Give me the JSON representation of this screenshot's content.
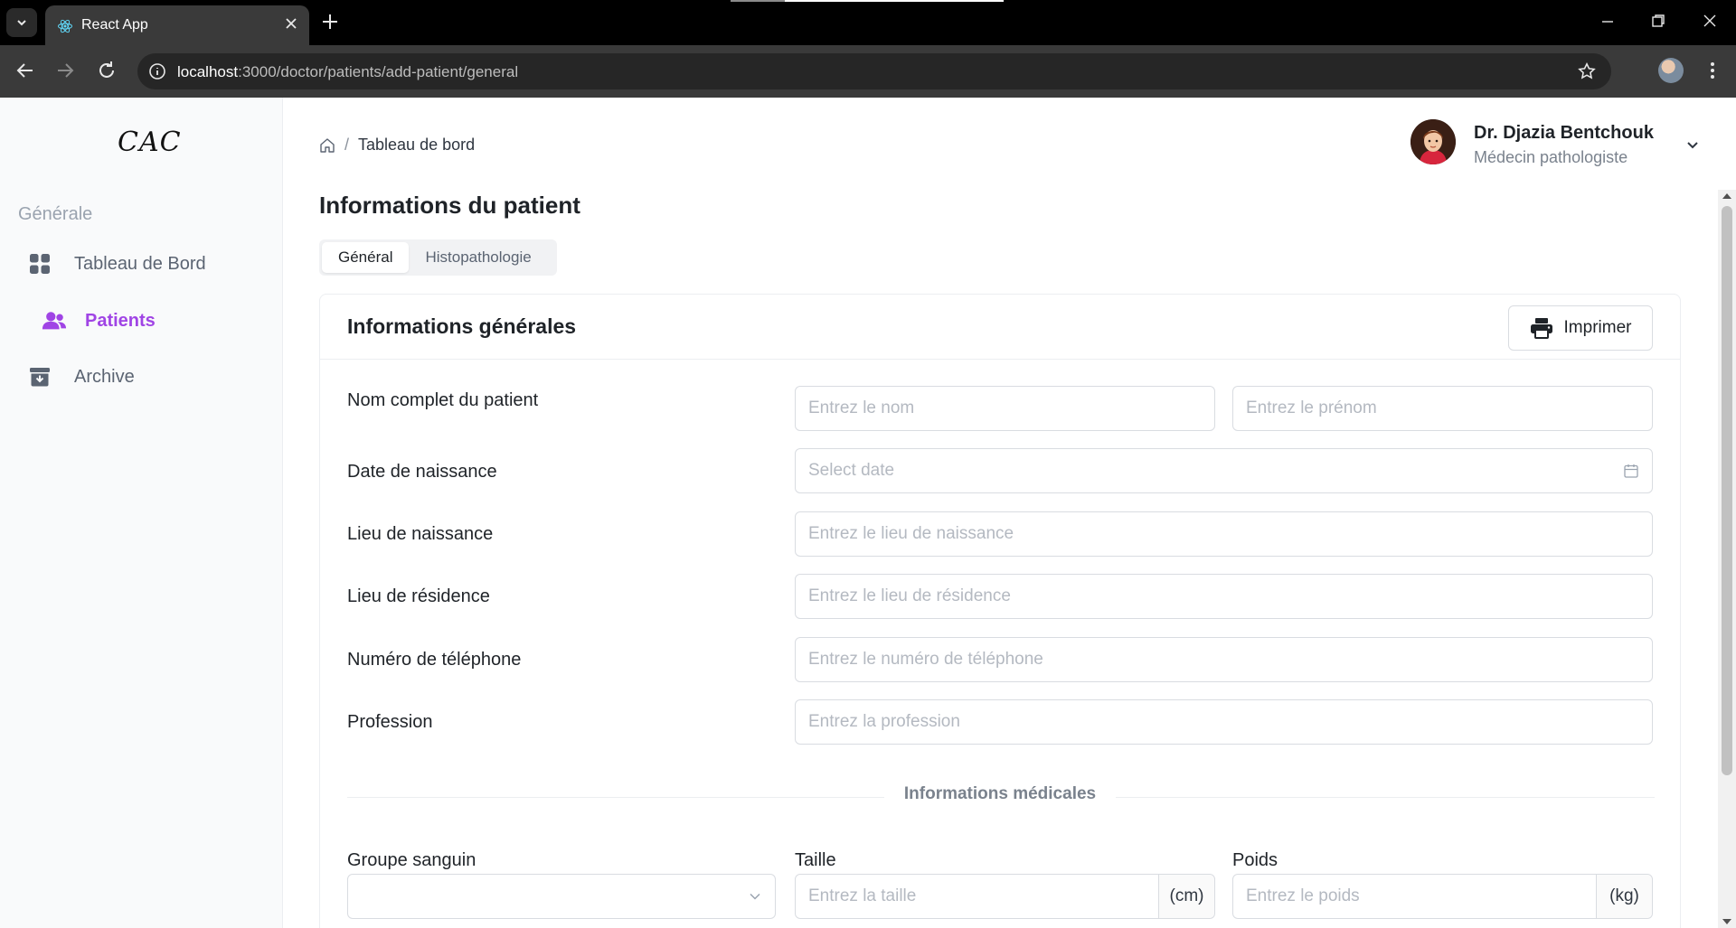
{
  "browser": {
    "tab_title": "React App",
    "url_host": "localhost",
    "url_rest": ":3000/doctor/patients/add-patient/general"
  },
  "sidebar": {
    "logo": "CAC",
    "section": "Générale",
    "items": [
      {
        "label": "Tableau de Bord",
        "icon": "grid-icon",
        "active": false
      },
      {
        "label": "Patients",
        "icon": "users-icon",
        "active": true
      },
      {
        "label": "Archive",
        "icon": "archive-icon",
        "active": false
      }
    ],
    "accent": "#a044e5"
  },
  "header": {
    "breadcrumb": "Tableau de bord",
    "user_name": "Dr. Djazia Bentchouk",
    "user_role": "Médecin pathologiste"
  },
  "page": {
    "title": "Informations du patient",
    "tabs": [
      "Général",
      "Histopathologie"
    ],
    "active_tab": "Général"
  },
  "form": {
    "card_title": "Informations générales",
    "print_label": "Imprimer",
    "labels": {
      "full_name": "Nom complet du patient",
      "birth_date": "Date de naissance",
      "birth_place": "Lieu de naissance",
      "residence": "Lieu de résidence",
      "phone": "Numéro de téléphone",
      "profession": "Profession"
    },
    "placeholders": {
      "last_name": "Entrez le nom",
      "first_name": "Entrez le prénom",
      "birth_date": "Select date",
      "birth_place": "Entrez le lieu de naissance",
      "residence": "Entrez le lieu de résidence",
      "phone": "Entrez le numéro de téléphone",
      "profession": "Entrez la profession"
    },
    "medical_divider": "Informations médicales",
    "medical": {
      "blood_group_label": "Groupe sanguin",
      "blood_group_value": "",
      "height_label": "Taille",
      "height_placeholder": "Entrez la taille",
      "height_unit": "(cm)",
      "weight_label": "Poids",
      "weight_placeholder": "Entrez le poids",
      "weight_unit": "(kg)"
    }
  }
}
